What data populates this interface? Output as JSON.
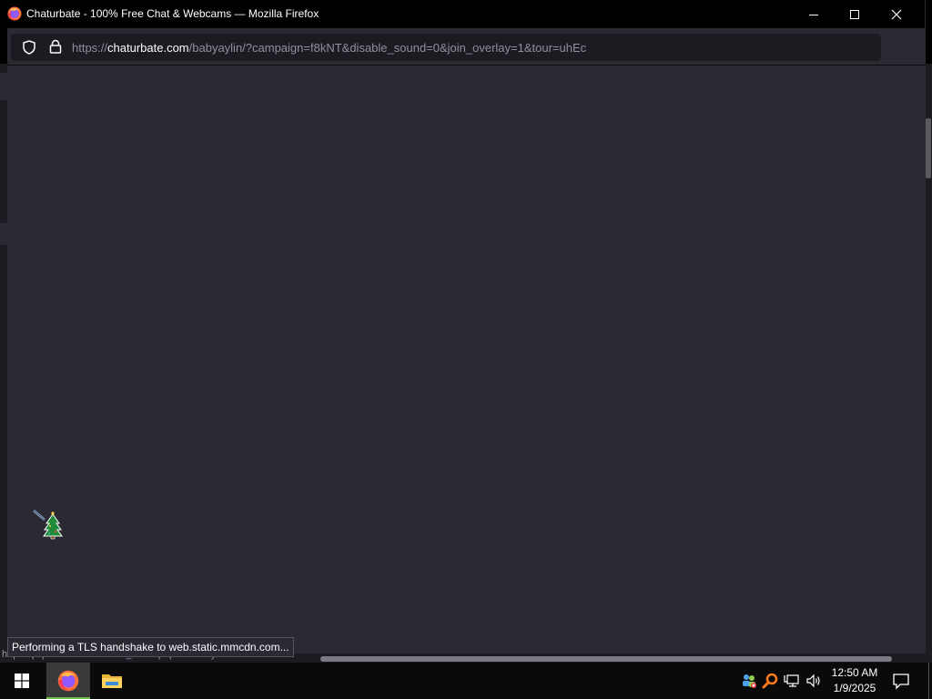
{
  "window": {
    "title": "Chaturbate - 100% Free Chat & Webcams — Mozilla Firefox"
  },
  "urlbar": {
    "prefix": "https://",
    "host": "chaturbate.com",
    "path": "/babyaylin/?campaign=f8kNT&disable_sound=0&join_overlay=1&tour=uhEc"
  },
  "status": {
    "tooltip": "Performing a TLS handshake to web.static.mmcdn.com...",
    "underlying_link": "https://pliporn.nub.com/view_video.php?viewkey=ab7e7e3a6687"
  },
  "taskbar": {
    "apps": [
      {
        "name": "firefox",
        "active": true
      },
      {
        "name": "file-explorer",
        "active": false
      }
    ],
    "clock": {
      "time": "12:50 AM",
      "date": "1/9/2025"
    }
  },
  "colors": {
    "content_bg": "#2b2a33",
    "titlebar_bg": "#000000",
    "taskbar_bg": "#0a0a0a"
  }
}
